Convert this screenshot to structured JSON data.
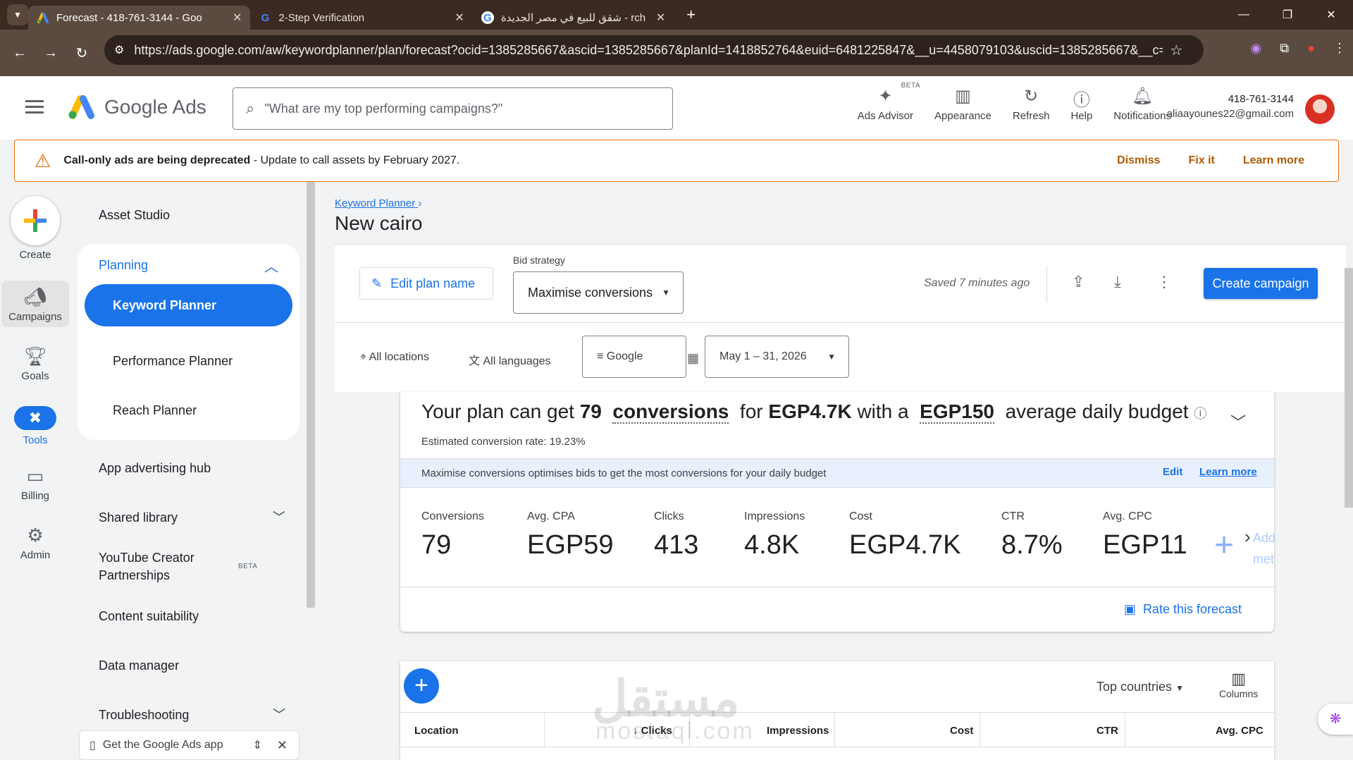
{
  "browser": {
    "tabs": [
      {
        "title": "Forecast - 418-761-3144 - Goo",
        "active": true
      },
      {
        "title": "2-Step Verification",
        "active": false
      },
      {
        "title": "شقق للبيع في مصر الجديدة - rch",
        "active": false
      }
    ],
    "url": "https://ads.google.com/aw/keywordplanner/plan/forecast?ocid=1385285667&ascid=1385285667&planId=1418852764&euid=6481225847&__u=4458079103&uscid=1385285667&__c=..."
  },
  "header": {
    "logo_text": "Google Ads",
    "search_placeholder": "\"What are my top performing campaigns?\"",
    "tools": [
      {
        "label": "Ads Advisor",
        "icon": "sparkle-icon",
        "badge": "BETA"
      },
      {
        "label": "Appearance",
        "icon": "appearance-icon"
      },
      {
        "label": "Refresh",
        "icon": "refresh-icon"
      },
      {
        "label": "Help",
        "icon": "help-icon"
      },
      {
        "label": "Notifications",
        "icon": "bell-icon"
      }
    ],
    "account_id": "418-761-3144",
    "account_email": "aliaayounes22@gmail.com"
  },
  "alert": {
    "title": "Call-only ads are being deprecated",
    "text": " - Update to call assets by February 2027.",
    "dismiss": "Dismiss",
    "fix": "Fix it",
    "learn": "Learn more",
    "color": "#e8710a"
  },
  "rail": {
    "create": "Create",
    "campaigns": "Campaigns",
    "goals": "Goals",
    "tools": "Tools",
    "billing": "Billing",
    "admin": "Admin"
  },
  "sidenav": {
    "asset_studio": "Asset Studio",
    "planning": "Planning",
    "keyword_planner": "Keyword Planner",
    "performance_planner": "Performance Planner",
    "reach_planner": "Reach Planner",
    "app_hub": "App advertising hub",
    "shared_library": "Shared library",
    "youtube_1": "YouTube Creator",
    "youtube_2": "Partnerships",
    "youtube_badge": "BETA",
    "content_suitability": "Content suitability",
    "data_manager": "Data manager",
    "troubleshooting": "Troubleshooting",
    "get_app": "Get the Google Ads app"
  },
  "main": {
    "breadcrumb": "Keyword Planner",
    "title": "New cairo",
    "edit_plan": "Edit plan name",
    "bid_label": "Bid strategy",
    "bid_value": "Maximise conversions",
    "saved": "Saved 7 minutes ago",
    "create_campaign": "Create campaign",
    "filters": {
      "locations": "All locations",
      "languages": "All languages",
      "network": "Google",
      "dates": "May 1 – 31, 2026"
    }
  },
  "forecast": {
    "h_pre": "Your plan can get ",
    "h_conv_num": "79",
    "h_conv_word": "conversions",
    "h_mid": " for ",
    "h_cost": "EGP4.7K",
    "h_with": " with a ",
    "h_budget": "EGP150",
    "h_post": " average daily budget",
    "rate": "Estimated conversion rate: 19.23%",
    "info": "Maximise conversions optimises bids to get the most conversions for your daily budget",
    "edit": "Edit",
    "learn": "Learn more",
    "metrics": [
      {
        "label": "Conversions",
        "value": "79"
      },
      {
        "label": "Avg. CPA",
        "value": "EGP59"
      },
      {
        "label": "Clicks",
        "value": "413"
      },
      {
        "label": "Impressions",
        "value": "4.8K"
      },
      {
        "label": "Cost",
        "value": "EGP4.7K"
      },
      {
        "label": "CTR",
        "value": "8.7%"
      },
      {
        "label": "Avg. CPC",
        "value": "EGP11"
      }
    ],
    "add_metric_1": "Add",
    "add_metric_2": "met",
    "rate_forecast": "Rate this forecast"
  },
  "table": {
    "top_countries": "Top countries",
    "columns": "Columns",
    "headers": [
      "Location",
      "Clicks",
      "Impressions",
      "Cost",
      "CTR",
      "Avg. CPC"
    ]
  },
  "watermark": {
    "line1": "مستقل",
    "line2": "mostaql.com"
  }
}
